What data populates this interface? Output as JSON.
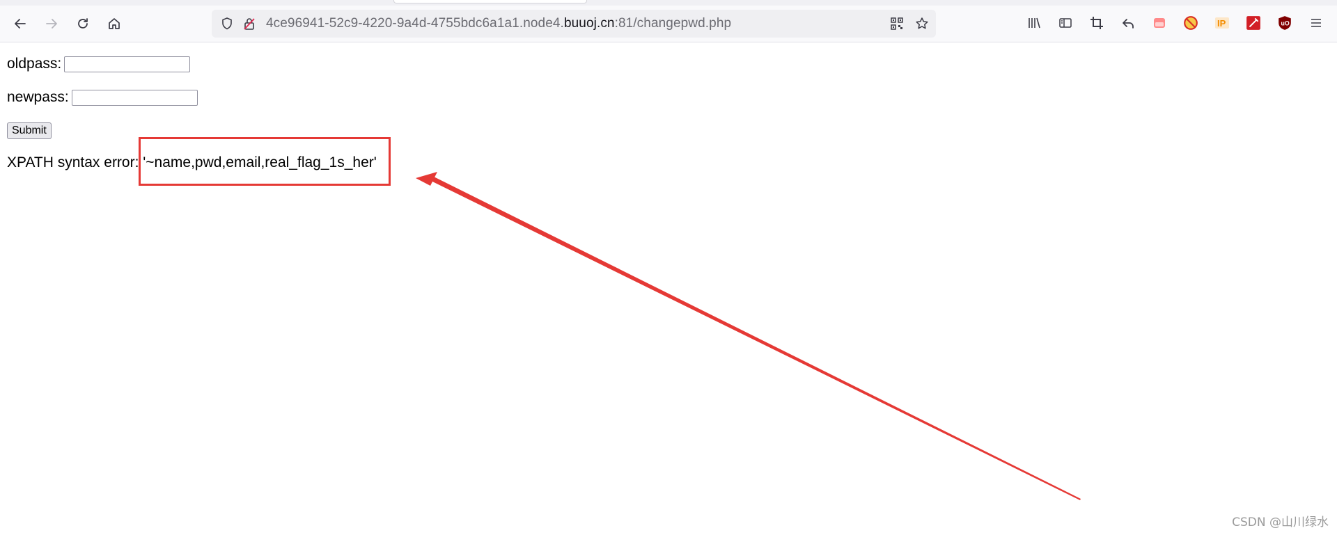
{
  "browser": {
    "url_prefix": "4ce96941-52c9-4220-9a4d-4755bdc6a1a1.node4.",
    "url_domain": "buuoj.cn",
    "url_suffix": ":81/changepwd.php"
  },
  "form": {
    "oldpass_label": "oldpass:",
    "oldpass_value": "",
    "newpass_label": "newpass:",
    "newpass_value": "",
    "submit_label": "Submit"
  },
  "error": {
    "label": "XPATH syntax error:",
    "value": "'~name,pwd,email,real_flag_1s_her'"
  },
  "annotation": {
    "color": "#e53935"
  },
  "watermark": "CSDN @山川绿水"
}
